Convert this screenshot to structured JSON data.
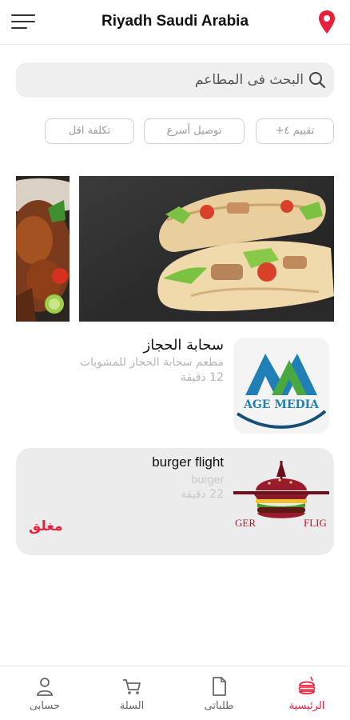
{
  "header": {
    "location": "Riyadh Saudi Arabia"
  },
  "search": {
    "placeholder": "البحث فى المطاعم"
  },
  "filters": {
    "rating": "تقييم ٤+",
    "delivery": "توصيل أسرع",
    "cost": "تكلفة اقل"
  },
  "restaurants": [
    {
      "name": "سحابة الحجاز",
      "description": "مطعم سحابة الحجاز للمشويات",
      "time": "12 دقيقة",
      "logo_text": "AGE MEDIA"
    },
    {
      "name": "burger flight",
      "description": "burger",
      "time": "22 دقيقة",
      "status": "مغلق",
      "logo_text_left": "GER",
      "logo_text_right": "FLIG"
    }
  ],
  "bottom_nav": {
    "home": "الرئيسية",
    "orders": "طلباتى",
    "cart": "السلة",
    "account": "حسابى"
  },
  "colors": {
    "accent": "#e8203a",
    "logo_blue": "#1f7fb6",
    "logo_green": "#49a83f"
  }
}
